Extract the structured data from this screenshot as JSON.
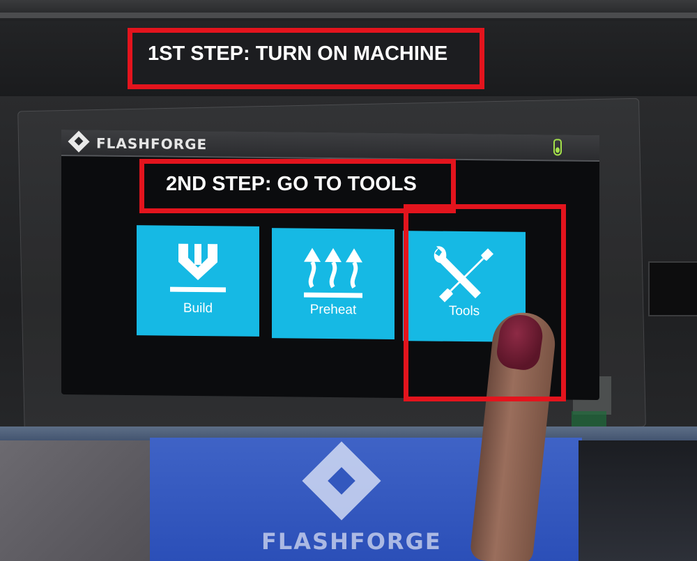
{
  "annotations": {
    "step1": "1ST STEP: TURN ON MACHINE",
    "step2": "2ND STEP: GO TO TOOLS"
  },
  "screen": {
    "brand": "FLASHFORGE",
    "status_icon": "thermometer-icon",
    "tiles": [
      {
        "label": "Build",
        "icon": "build-icon"
      },
      {
        "label": "Preheat",
        "icon": "preheat-icon"
      },
      {
        "label": "Tools",
        "icon": "tools-icon"
      }
    ]
  },
  "printer_front": {
    "brand": "FLASHFORGE"
  },
  "colors": {
    "tile": "#16b9e4",
    "annotation": "#e3141d",
    "front_panel": "#2b4fb8"
  }
}
